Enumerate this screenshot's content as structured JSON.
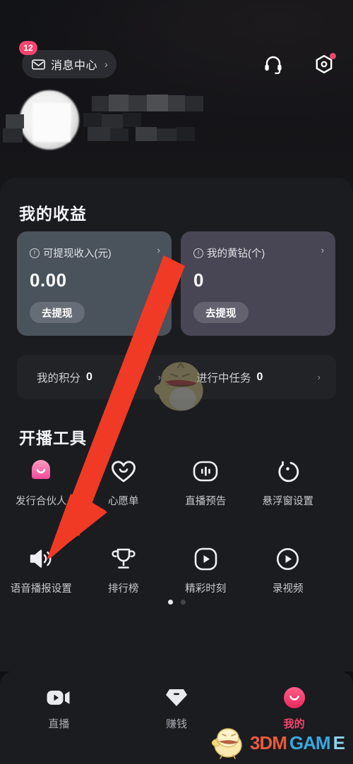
{
  "header": {
    "message_center": {
      "label": "消息中心",
      "badge": "12",
      "chevron": "›",
      "icon": "envelope-icon"
    },
    "support_icon": "headset-icon",
    "settings_icon": "hexagon-settings-icon",
    "settings_has_dot": true
  },
  "profile": {
    "avatar": "blurred-avatar",
    "name_masked": true
  },
  "earnings": {
    "title": "我的收益",
    "cards": [
      {
        "label": "可提现收入(元)",
        "value": "0.00",
        "button": "去提现",
        "chevron": "›",
        "info_icon": "info-icon",
        "color": "#4a525c"
      },
      {
        "label": "我的黄钻(个)",
        "value": "0",
        "button": "去提现",
        "chevron": "›",
        "info_icon": "info-icon",
        "color": "#484554"
      }
    ],
    "strip": [
      {
        "label": "我的积分",
        "value": "0",
        "chevron": "›"
      },
      {
        "label": "进行中任务",
        "value": "0",
        "chevron": "›"
      }
    ]
  },
  "tools": {
    "title": "开播工具",
    "items": [
      {
        "label": "发行合伙人",
        "icon": "partner-avatar-icon"
      },
      {
        "label": "心愿单",
        "icon": "heart-icon"
      },
      {
        "label": "直播预告",
        "icon": "broadcast-preview-icon"
      },
      {
        "label": "悬浮窗设置",
        "icon": "floating-window-icon"
      },
      {
        "label": "语音播报设置",
        "icon": "speaker-icon"
      },
      {
        "label": "排行榜",
        "icon": "trophy-icon"
      },
      {
        "label": "精彩时刻",
        "icon": "highlight-play-icon"
      },
      {
        "label": "录视频",
        "icon": "record-play-icon"
      }
    ],
    "pager": {
      "count": 2,
      "active": 0
    }
  },
  "tabbar": {
    "items": [
      {
        "label": "直播",
        "icon": "video-camera-icon",
        "active": false
      },
      {
        "label": "赚钱",
        "icon": "diamond-icon",
        "active": false
      },
      {
        "label": "我的",
        "icon": "smiley-face-icon",
        "active": true
      }
    ],
    "active_color": "#f4456f"
  },
  "annotation": {
    "type": "red-arrow",
    "points_to": "语音播报设置",
    "color": "#f03a25"
  },
  "watermark": {
    "text_parts": [
      "3DM",
      "GAM",
      "E"
    ],
    "mascot": "chick-mascot"
  }
}
